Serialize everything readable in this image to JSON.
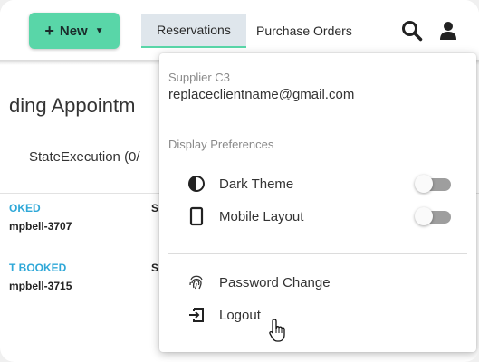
{
  "topbar": {
    "new_button_label": "New",
    "tabs": [
      {
        "label": "Reservations",
        "active": true
      },
      {
        "label": "Purchase Orders",
        "active": false
      }
    ]
  },
  "page": {
    "title": "ding Appointm",
    "column_header": "StateExecution (0/",
    "rows": [
      {
        "status": "OKED",
        "name": "mpbell-3707",
        "col2": "S"
      },
      {
        "status": "T BOOKED",
        "name": "mpbell-3715",
        "col2": "S"
      }
    ]
  },
  "user_menu": {
    "supplier": "Supplier C3",
    "email": "replaceclientname@gmail.com",
    "section_title": "Display Preferences",
    "preferences": [
      {
        "label": "Dark Theme",
        "icon": "contrast-icon",
        "enabled": false
      },
      {
        "label": "Mobile Layout",
        "icon": "phone-icon",
        "enabled": false
      }
    ],
    "actions": [
      {
        "label": "Password Change",
        "icon": "fingerprint-icon"
      },
      {
        "label": "Logout",
        "icon": "logout-icon"
      }
    ]
  },
  "colors": {
    "accent": "#59d6a8",
    "status_blue": "#2fa8d8",
    "tab_active_bg": "#dfe6ec"
  }
}
